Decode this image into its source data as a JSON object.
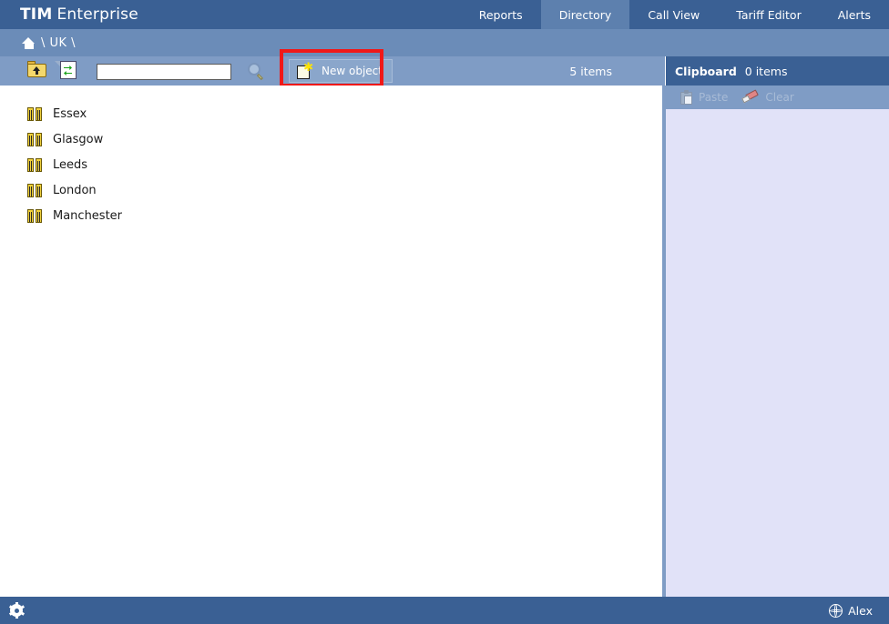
{
  "header": {
    "brand_strong": "TIM",
    "brand_light": "Enterprise",
    "tabs": [
      {
        "label": "Reports",
        "active": false
      },
      {
        "label": "Directory",
        "active": true
      },
      {
        "label": "Call View",
        "active": false
      },
      {
        "label": "Tariff Editor",
        "active": false
      },
      {
        "label": "Alerts",
        "active": false
      }
    ]
  },
  "breadcrumb": {
    "home_icon": "home-icon",
    "path": "\\ UK \\"
  },
  "toolbar": {
    "up_icon": "folder-up-icon",
    "refresh_icon": "refresh-icon",
    "search_value": "",
    "search_placeholder": "",
    "search_icon": "magnifier-icon",
    "new_object_icon": "new-object-icon",
    "new_object_label": "New object",
    "item_count": "5 items",
    "highlight_color": "#f01818"
  },
  "directory": {
    "items": [
      {
        "label": "Essex",
        "icon": "site-icon"
      },
      {
        "label": "Glasgow",
        "icon": "site-icon"
      },
      {
        "label": "Leeds",
        "icon": "site-icon"
      },
      {
        "label": "London",
        "icon": "site-icon"
      },
      {
        "label": "Manchester",
        "icon": "site-icon"
      }
    ]
  },
  "clipboard": {
    "title": "Clipboard",
    "count": "0 items",
    "paste_icon": "paste-icon",
    "paste_label": "Paste",
    "clear_icon": "eraser-icon",
    "clear_label": "Clear"
  },
  "footer": {
    "settings_icon": "gear-icon",
    "user_icon": "globe-icon",
    "user_label": "Alex"
  },
  "colors": {
    "header_blue": "#3a6094",
    "active_tab_blue": "#5d80ae",
    "breadcrumb_blue": "#6b8cb8",
    "toolbar_blue": "#7f9cc5",
    "clipboard_body": "#e1e2f8",
    "highlight_red": "#f01818"
  }
}
